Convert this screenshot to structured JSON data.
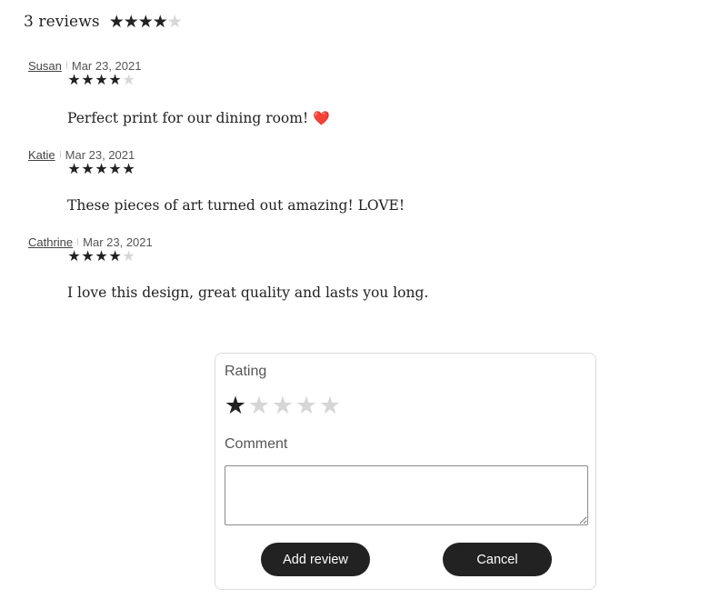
{
  "summary": {
    "count_label": "3 reviews",
    "rating": 4,
    "max": 5
  },
  "reviews": [
    {
      "author": "Susan",
      "date": "Mar 23, 2021",
      "rating": 4,
      "text": "Perfect print for our dining room!",
      "emoji": "❤️"
    },
    {
      "author": "Katie",
      "date": "Mar 23, 2021",
      "rating": 5,
      "text": "These pieces of art turned out amazing! LOVE!"
    },
    {
      "author": "Cathrine",
      "date": "Mar 23, 2021",
      "rating": 4,
      "text": "I love this design, great quality and lasts you long."
    }
  ],
  "form": {
    "rating_label": "Rating",
    "rating_value": 1,
    "rating_max": 5,
    "comment_label": "Comment",
    "comment_value": "",
    "submit_label": "Add review",
    "cancel_label": "Cancel"
  },
  "colors": {
    "star_on": "#222222",
    "star_off": "#d6d6d6",
    "button_bg": "#222222",
    "button_text": "#ffffff"
  },
  "icons": {
    "star_filled": "star-icon",
    "star_empty": "star-outline-icon",
    "heart": "heart-icon"
  }
}
